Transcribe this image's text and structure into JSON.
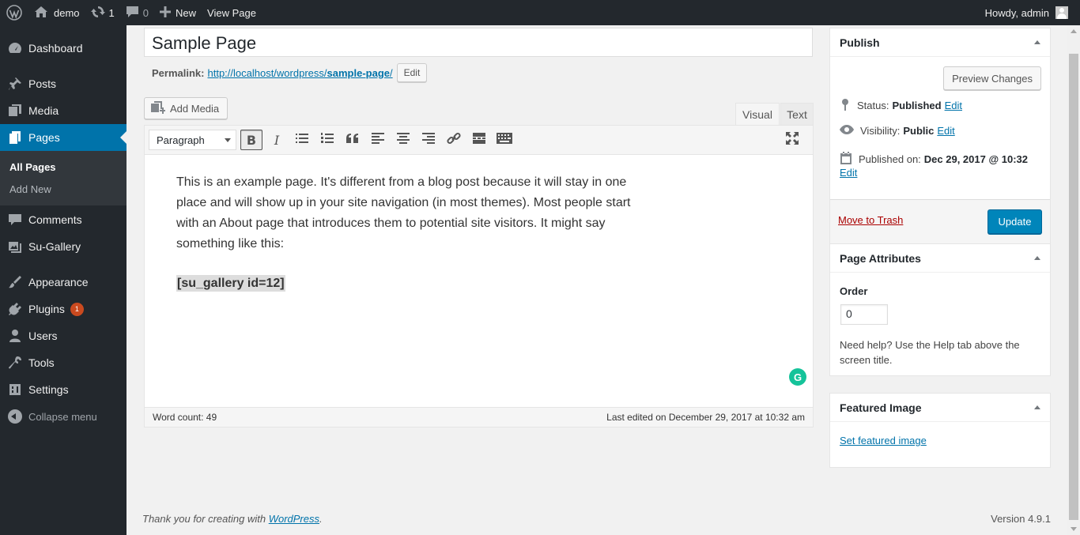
{
  "adminbar": {
    "site_name": "demo",
    "updates_count": "1",
    "comments_count": "0",
    "new_label": "New",
    "view_page_label": "View Page",
    "howdy": "Howdy, admin"
  },
  "sidebar": {
    "items": [
      {
        "label": "Dashboard",
        "icon": "dashboard-icon"
      },
      {
        "label": "Posts",
        "icon": "pin-icon"
      },
      {
        "label": "Media",
        "icon": "media-icon"
      },
      {
        "label": "Pages",
        "icon": "pages-icon",
        "current": true
      },
      {
        "label": "Comments",
        "icon": "comments-icon"
      },
      {
        "label": "Su-Gallery",
        "icon": "gallery-icon"
      },
      {
        "label": "Appearance",
        "icon": "brush-icon"
      },
      {
        "label": "Plugins",
        "icon": "plugin-icon",
        "badge": "1"
      },
      {
        "label": "Users",
        "icon": "users-icon"
      },
      {
        "label": "Tools",
        "icon": "wrench-icon"
      },
      {
        "label": "Settings",
        "icon": "settings-icon"
      }
    ],
    "submenu": [
      "All Pages",
      "Add New"
    ],
    "collapse_label": "Collapse menu"
  },
  "editor": {
    "title": "Sample Page",
    "permalink_label": "Permalink:",
    "permalink_base": "http://localhost/wordpress/",
    "permalink_slug": "sample-page",
    "permalink_trail": "/",
    "permalink_edit": "Edit",
    "add_media": "Add Media",
    "tab_visual": "Visual",
    "tab_text": "Text",
    "format_value": "Paragraph",
    "paragraph": "This is an example page. It's different from a blog post because it will stay in one place and will show up in your site navigation (in most themes). Most people start with an About page that introduces them to potential site visitors. It might say something like this:",
    "shortcode": "[su_gallery id=12]",
    "word_count": "Word count: 49",
    "last_edited": "Last edited on December 29, 2017 at 10:32 am"
  },
  "publish": {
    "heading": "Publish",
    "preview": "Preview Changes",
    "status_label": "Status:",
    "status_value": "Published",
    "visibility_label": "Visibility:",
    "visibility_value": "Public",
    "published_label": "Published on:",
    "published_value": "Dec 29, 2017 @ 10:32",
    "edit": "Edit",
    "trash": "Move to Trash",
    "update": "Update"
  },
  "attributes": {
    "heading": "Page Attributes",
    "order_label": "Order",
    "order_value": "0",
    "help": "Need help? Use the Help tab above the screen title."
  },
  "featured": {
    "heading": "Featured Image",
    "set_link": "Set featured image"
  },
  "footer": {
    "thanks": "Thank you for creating with ",
    "link": "WordPress",
    "period": ".",
    "version": "Version 4.9.1"
  },
  "colors": {
    "admin_dark": "#23282d",
    "accent": "#0073aa",
    "button_primary": "#0085ba",
    "trash": "#aa0000",
    "badge": "#ca4a1f"
  }
}
